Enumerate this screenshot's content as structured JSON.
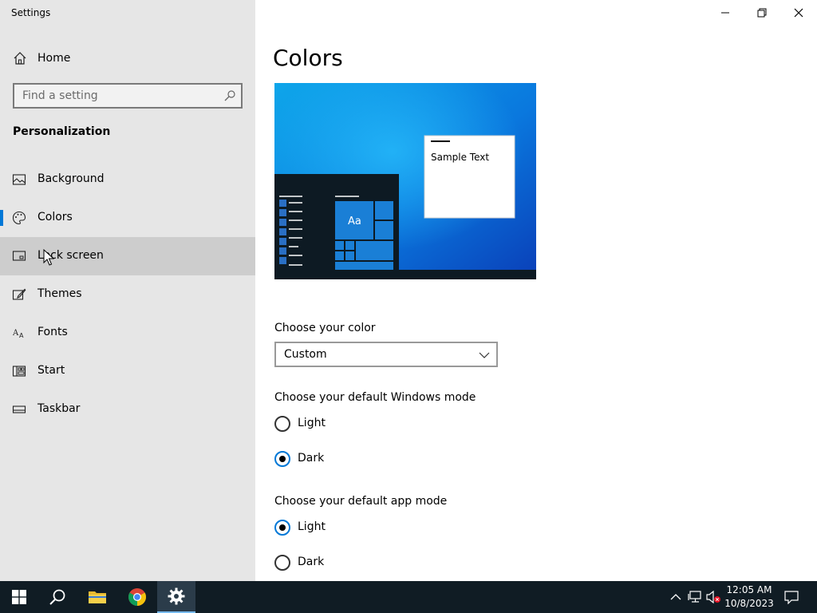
{
  "window": {
    "title": "Settings"
  },
  "sidebar": {
    "home_label": "Home",
    "search_placeholder": "Find a setting",
    "section_title": "Personalization",
    "items": [
      {
        "label": "Background",
        "icon": "picture-icon"
      },
      {
        "label": "Colors",
        "icon": "palette-icon",
        "selected": true
      },
      {
        "label": "Lock screen",
        "icon": "lock-screen-icon",
        "hover": true
      },
      {
        "label": "Themes",
        "icon": "brush-icon"
      },
      {
        "label": "Fonts",
        "icon": "fonts-icon"
      },
      {
        "label": "Start",
        "icon": "start-layout-icon"
      },
      {
        "label": "Taskbar",
        "icon": "taskbar-icon"
      }
    ]
  },
  "main": {
    "page_title": "Colors",
    "preview": {
      "sample_text": "Sample Text",
      "tile_text": "Aa"
    },
    "choose_color": {
      "label": "Choose your color",
      "value": "Custom"
    },
    "windows_mode": {
      "label": "Choose your default Windows mode",
      "options": [
        "Light",
        "Dark"
      ],
      "selected": "Dark"
    },
    "app_mode": {
      "label": "Choose your default app mode",
      "options": [
        "Light",
        "Dark"
      ],
      "selected": "Light"
    }
  },
  "taskbar": {
    "time": "12:05 AM",
    "date": "10/8/2023"
  },
  "colors": {
    "accent": "#0078d7",
    "sidebar_bg": "#e6e6e6",
    "taskbar_bg": "#101c24"
  }
}
